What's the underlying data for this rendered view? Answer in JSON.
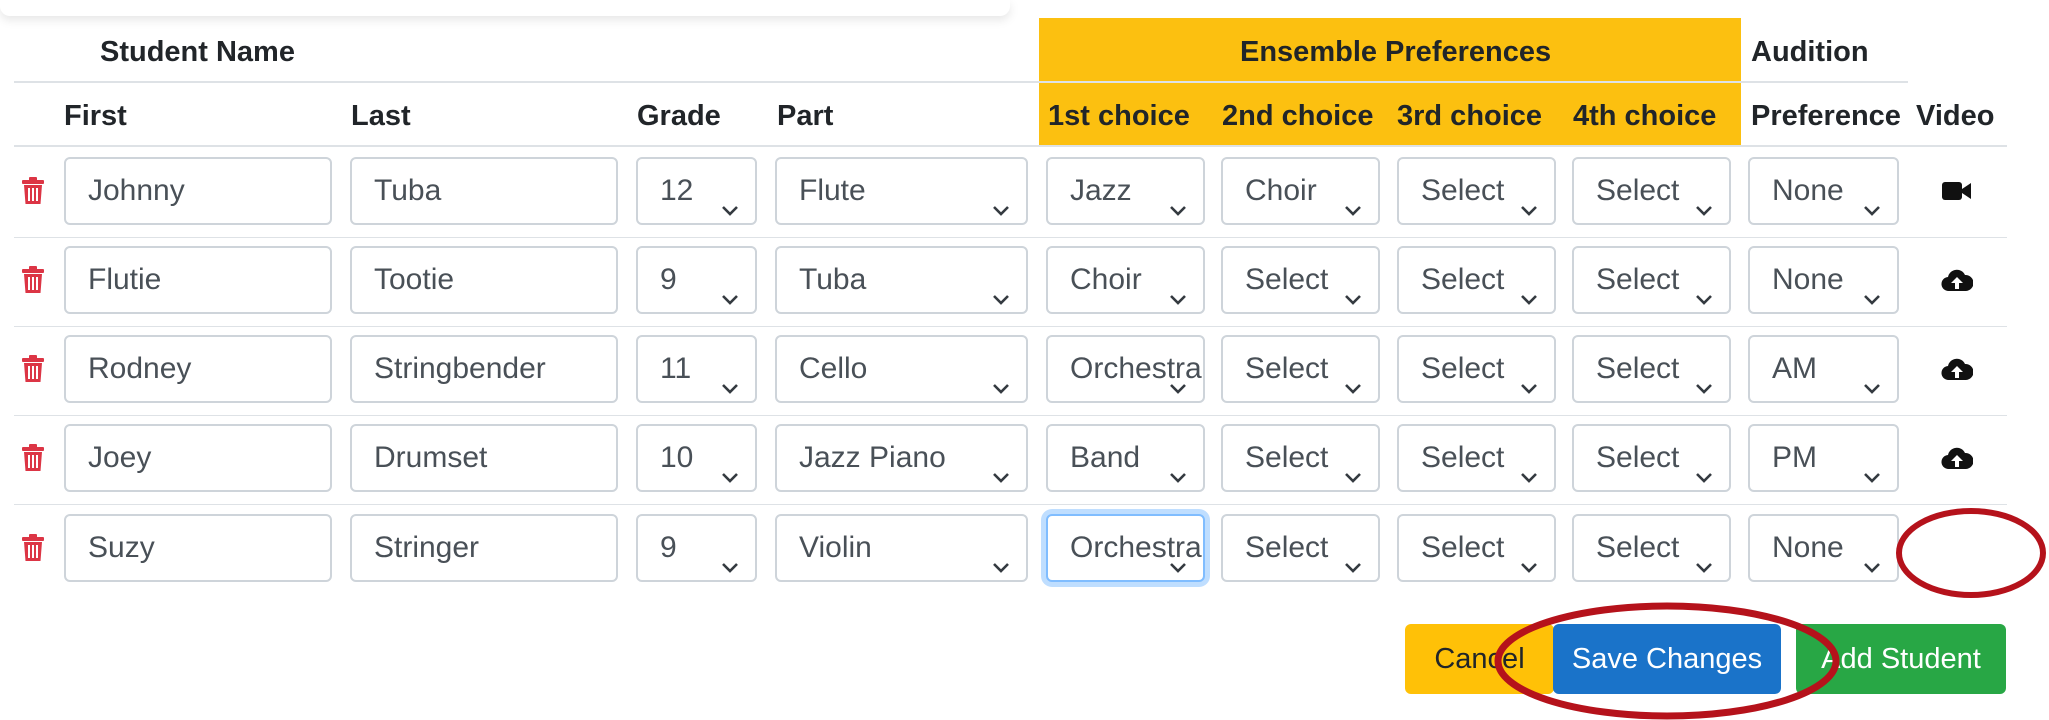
{
  "header": {
    "group_student_name": "Student Name",
    "group_ensemble": "Ensemble Preferences",
    "group_audition": "Audition",
    "col_first": "First",
    "col_last": "Last",
    "col_grade": "Grade",
    "col_part": "Part",
    "col_choice1": "1st choice",
    "col_choice2": "2nd choice",
    "col_choice3": "3rd choice",
    "col_choice4": "4th choice",
    "col_preference": "Preference",
    "col_video": "Video"
  },
  "rows": [
    {
      "first": "Johnny",
      "last": "Tuba",
      "grade": "12",
      "part": "Flute",
      "c1": "Jazz",
      "c2": "Choir",
      "c3": "Select",
      "c4": "Select",
      "pref": "None",
      "video_icon": "video-camera-icon"
    },
    {
      "first": "Flutie",
      "last": "Tootie",
      "grade": "9",
      "part": "Tuba",
      "c1": "Choir",
      "c2": "Select",
      "c3": "Select",
      "c4": "Select",
      "pref": "None",
      "video_icon": "cloud-upload-icon"
    },
    {
      "first": "Rodney",
      "last": "Stringbender",
      "grade": "11",
      "part": "Cello",
      "c1": "Orchestra",
      "c2": "Select",
      "c3": "Select",
      "c4": "Select",
      "pref": "AM",
      "video_icon": "cloud-upload-icon"
    },
    {
      "first": "Joey",
      "last": "Drumset",
      "grade": "10",
      "part": "Jazz Piano",
      "c1": "Band",
      "c2": "Select",
      "c3": "Select",
      "c4": "Select",
      "pref": "PM",
      "video_icon": "cloud-upload-icon"
    },
    {
      "first": "Suzy",
      "last": "Stringer",
      "grade": "9",
      "part": "Violin",
      "c1": "Orchestra",
      "c2": "Select",
      "c3": "Select",
      "c4": "Select",
      "pref": "None",
      "video_icon": ""
    }
  ],
  "buttons": {
    "cancel": "Cancel",
    "save": "Save Changes",
    "add": "Add Student"
  },
  "colors": {
    "ensemble_header": "#fcc010",
    "trash": "#dc3545",
    "save_button": "#1a73c9",
    "add_button": "#28a745",
    "cancel_button": "#ffc107",
    "annotation_circle": "#b5121b"
  }
}
